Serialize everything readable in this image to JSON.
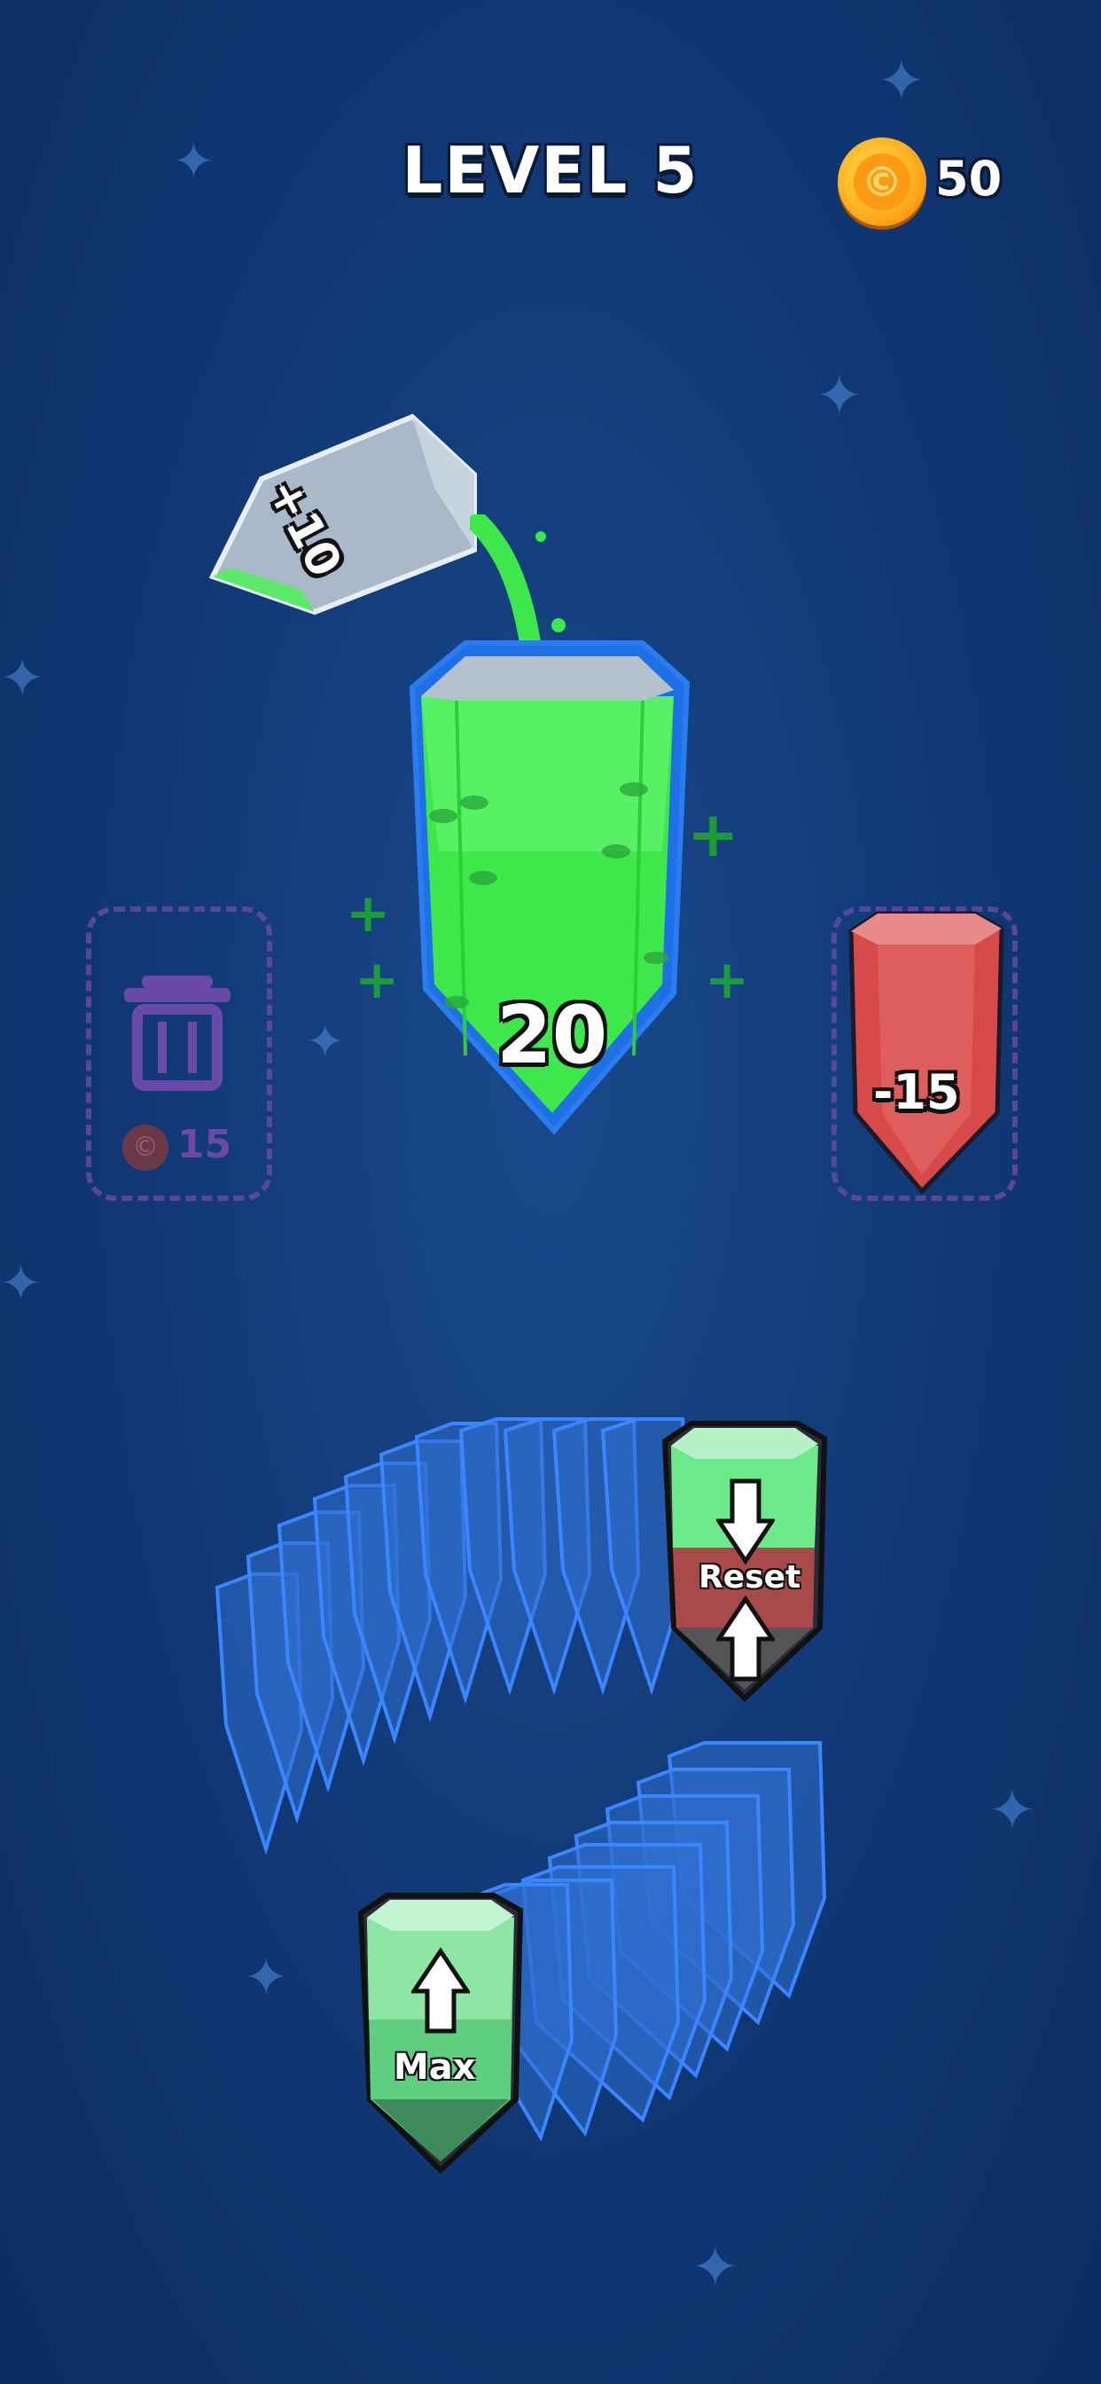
{
  "header": {
    "level_title": "LEVEL 5",
    "coins": "50"
  },
  "pouring_crystal": {
    "label": "+10"
  },
  "main_crystal": {
    "value": "20",
    "color": "#3ee84a"
  },
  "trash_slot": {
    "cost": "15",
    "icon": "trash-icon"
  },
  "right_slot": {
    "crystal_label": "-15",
    "crystal_color": "#d84a4a"
  },
  "upgrades": {
    "reset_label": "Reset",
    "max_label": "Max"
  },
  "colors": {
    "background": "#123a78",
    "coin": "#ffb020",
    "slot_outline": "#6a4aa8",
    "stack_blue": "#3a7ad8"
  }
}
